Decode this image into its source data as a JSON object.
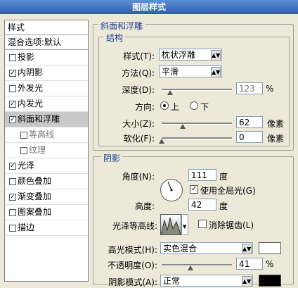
{
  "window": {
    "title": "图层样式"
  },
  "sidebar": {
    "styles_header": "样式",
    "blend_options": "混合选项:默认",
    "items": [
      {
        "label": "投影",
        "checked": false,
        "sub": false
      },
      {
        "label": "内阴影",
        "checked": true,
        "sub": false
      },
      {
        "label": "外发光",
        "checked": false,
        "sub": false
      },
      {
        "label": "内发光",
        "checked": true,
        "sub": false
      },
      {
        "label": "斜面和浮雕",
        "checked": true,
        "sub": false,
        "selected": true
      },
      {
        "label": "等高线",
        "checked": false,
        "sub": true
      },
      {
        "label": "纹理",
        "checked": false,
        "sub": true
      },
      {
        "label": "光泽",
        "checked": true,
        "sub": false
      },
      {
        "label": "颜色叠加",
        "checked": false,
        "sub": false
      },
      {
        "label": "渐变叠加",
        "checked": true,
        "sub": false
      },
      {
        "label": "图案叠加",
        "checked": false,
        "sub": false
      },
      {
        "label": "描边",
        "checked": false,
        "sub": false
      }
    ]
  },
  "bevel": {
    "section_title": "斜面和浮雕",
    "structure_title": "结构",
    "style_label": "样式(T):",
    "style_value": "枕状浮雕",
    "technique_label": "方法(Q):",
    "technique_value": "平滑",
    "depth_label": "深度(D):",
    "depth_value": "123",
    "depth_unit": "%",
    "depth_level": 0.12,
    "direction_label": "方向:",
    "direction_up": "上",
    "direction_down": "下",
    "size_label": "大小(Z):",
    "size_value": "62",
    "size_unit": "像素",
    "size_level": 0.3,
    "soften_label": "软化(F):",
    "soften_value": "0",
    "soften_unit": "像素",
    "soften_level": 0.0
  },
  "shading": {
    "section_title": "阴影",
    "angle_label": "角度(N):",
    "angle_value": "111",
    "angle_unit": "度",
    "global_light_label": "使用全局光(G)",
    "altitude_label": "高度:",
    "altitude_value": "42",
    "altitude_unit": "度",
    "gloss_label": "光泽等高线:",
    "antialias_label": "消除锯齿(L)",
    "highlight_label": "高光模式(H):",
    "highlight_value": "实色混合",
    "opacity1_label": "不透明度(O):",
    "opacity1_value": "41",
    "opacity1_unit": "%",
    "opacity1_level": 0.41,
    "shadow_label": "阴影模式(A):",
    "shadow_value": "正常",
    "highlight_color": "#ffffff",
    "shadow_color": "#000000"
  }
}
